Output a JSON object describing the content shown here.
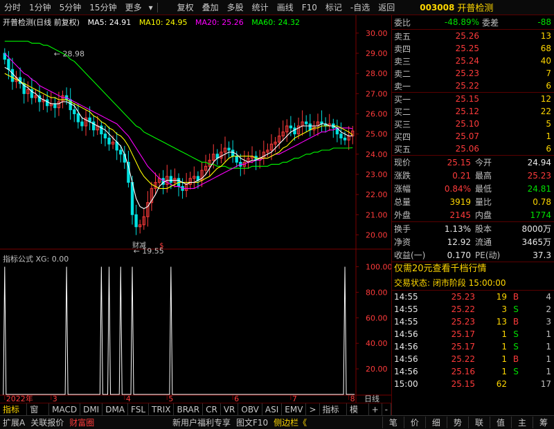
{
  "topbar": {
    "left_buttons": [
      "分时",
      "1分钟",
      "5分钟",
      "15分钟",
      "更多"
    ],
    "right_buttons": [
      "复权",
      "叠加",
      "多股",
      "统计",
      "画线",
      "F10",
      "标记",
      "-自选",
      "返回"
    ],
    "stock_code": "003008",
    "stock_name": "开普检测"
  },
  "chart_header": {
    "title": "开普检测(日线 前复权)",
    "ma5": "MA5: 24.91",
    "ma10": "MA10: 24.95",
    "ma20": "MA20: 25.26",
    "ma60": "MA60: 24.32"
  },
  "indicator_header": {
    "label": "指标公式 XG: 0.00"
  },
  "annotations": {
    "high": "28.98",
    "low": "19.55",
    "note1": "财减",
    "note2": "$"
  },
  "colors": {
    "ma5": "#ffffff",
    "ma10": "#ffff00",
    "ma20": "#ff00ff",
    "ma60": "#00ff00",
    "up": "#ff3b3b",
    "down": "#00e0e0",
    "axis_line": "#7a0000",
    "grid": "#3a0000"
  },
  "chart_data": [
    {
      "type": "candlestick",
      "title": "开普检测(日线 前复权)",
      "xlabel": "",
      "ylabel": "",
      "ylim": [
        19.5,
        30.2
      ],
      "y_ticks": [
        20,
        21,
        22,
        23,
        24,
        25,
        26,
        27,
        28,
        29,
        30
      ],
      "x_ticks": [
        {
          "index": 0,
          "label": "2022年"
        },
        {
          "index": 12,
          "label": "3"
        },
        {
          "index": 31,
          "label": "4"
        },
        {
          "index": 42,
          "label": "5"
        },
        {
          "index": 59,
          "label": "6"
        },
        {
          "index": 74,
          "label": "7"
        },
        {
          "index": 89,
          "label": "8"
        }
      ],
      "x_right_label": "日线",
      "legend": [
        "MA5",
        "MA10",
        "MA20",
        "MA60"
      ],
      "closes": [
        28.7,
        28.2,
        27.6,
        27.8,
        27.5,
        27.0,
        27.2,
        26.8,
        26.9,
        26.6,
        26.7,
        26.4,
        26.5,
        26.3,
        26.6,
        26.9,
        26.7,
        26.2,
        26.0,
        25.6,
        25.4,
        25.8,
        25.6,
        25.2,
        25.4,
        25.0,
        24.8,
        24.5,
        24.6,
        24.2,
        24.0,
        23.6,
        22.6,
        21.0,
        20.4,
        20.5,
        20.9,
        21.6,
        22.3,
        22.6,
        22.8,
        22.5,
        22.9,
        22.6,
        22.8,
        22.4,
        22.2,
        22.5,
        22.8,
        22.9,
        22.7,
        23.2,
        23.4,
        23.7,
        24.0,
        23.8,
        24.1,
        24.3,
        24.2,
        23.9,
        23.6,
        23.4,
        23.6,
        23.8,
        23.9,
        23.7,
        23.8,
        24.1,
        24.2,
        24.5,
        24.6,
        24.9,
        25.1,
        25.4,
        25.3,
        25.0,
        25.4,
        25.6,
        25.5,
        25.2,
        25.4,
        25.6,
        25.5,
        25.4,
        25.5,
        25.3,
        25.0,
        24.8,
        24.7,
        24.9,
        25.15
      ],
      "ma5": [
        28.3,
        28.2,
        28.0,
        27.8,
        27.6,
        27.4,
        27.3,
        27.1,
        27.0,
        26.8,
        26.7,
        26.6,
        26.5,
        26.5,
        26.5,
        26.6,
        26.6,
        26.5,
        26.4,
        26.1,
        25.8,
        25.7,
        25.6,
        25.5,
        25.4,
        25.3,
        25.2,
        25.0,
        24.8,
        24.6,
        24.4,
        24.0,
        23.4,
        22.6,
        21.8,
        21.4,
        21.3,
        21.4,
        21.7,
        22.0,
        22.4,
        22.6,
        22.7,
        22.7,
        22.7,
        22.7,
        22.6,
        22.5,
        22.6,
        22.6,
        22.7,
        22.8,
        23.0,
        23.3,
        23.6,
        23.8,
        23.9,
        24.0,
        24.1,
        24.1,
        24.0,
        23.8,
        23.7,
        23.6,
        23.7,
        23.7,
        23.8,
        23.9,
        24.0,
        24.1,
        24.3,
        24.5,
        24.7,
        24.9,
        25.1,
        25.2,
        25.3,
        25.4,
        25.4,
        25.4,
        25.4,
        25.4,
        25.5,
        25.5,
        25.4,
        25.4,
        25.3,
        25.1,
        25.0,
        24.9,
        24.91
      ],
      "ma10": [
        28.0,
        27.9,
        27.8,
        27.7,
        27.6,
        27.5,
        27.4,
        27.3,
        27.2,
        27.1,
        27.0,
        26.9,
        26.8,
        26.8,
        26.7,
        26.7,
        26.7,
        26.6,
        26.5,
        26.4,
        26.3,
        26.2,
        26.1,
        25.9,
        25.8,
        25.6,
        25.5,
        25.3,
        25.2,
        25.0,
        24.9,
        24.7,
        24.4,
        24.0,
        23.6,
        23.2,
        22.9,
        22.7,
        22.5,
        22.4,
        22.3,
        22.3,
        22.3,
        22.4,
        22.5,
        22.6,
        22.6,
        22.6,
        22.6,
        22.6,
        22.6,
        22.7,
        22.8,
        22.9,
        23.1,
        23.3,
        23.4,
        23.6,
        23.8,
        23.9,
        23.9,
        23.9,
        23.9,
        23.9,
        23.9,
        23.8,
        23.8,
        23.8,
        23.8,
        23.9,
        24.0,
        24.1,
        24.3,
        24.4,
        24.6,
        24.8,
        24.9,
        25.0,
        25.1,
        25.2,
        25.3,
        25.3,
        25.4,
        25.4,
        25.4,
        25.4,
        25.4,
        25.3,
        25.2,
        25.1,
        24.95
      ],
      "ma20": [
        29.0,
        28.8,
        28.6,
        28.4,
        28.2,
        28.0,
        27.9,
        27.7,
        27.6,
        27.4,
        27.3,
        27.2,
        27.1,
        27.0,
        26.9,
        26.8,
        26.8,
        26.7,
        26.6,
        26.5,
        26.4,
        26.3,
        26.2,
        26.1,
        26.0,
        25.9,
        25.8,
        25.7,
        25.6,
        25.5,
        25.3,
        25.1,
        24.9,
        24.6,
        24.3,
        24.0,
        23.7,
        23.4,
        23.2,
        23.0,
        22.8,
        22.7,
        22.6,
        22.5,
        22.4,
        22.4,
        22.3,
        22.3,
        22.3,
        22.3,
        22.4,
        22.5,
        22.6,
        22.7,
        22.8,
        22.9,
        23.0,
        23.1,
        23.2,
        23.3,
        23.4,
        23.5,
        23.5,
        23.6,
        23.6,
        23.7,
        23.7,
        23.8,
        23.8,
        23.9,
        24.0,
        24.0,
        24.1,
        24.2,
        24.3,
        24.4,
        24.5,
        24.6,
        24.7,
        24.8,
        24.9,
        25.0,
        25.1,
        25.1,
        25.2,
        25.2,
        25.3,
        25.3,
        25.3,
        25.3,
        25.26
      ],
      "ma60": [
        29.6,
        29.6,
        29.6,
        29.6,
        29.6,
        29.6,
        29.6,
        29.5,
        29.5,
        29.5,
        29.4,
        29.4,
        29.3,
        29.2,
        29.1,
        29.0,
        28.9,
        28.7,
        28.6,
        28.4,
        28.2,
        28.0,
        27.8,
        27.6,
        27.4,
        27.2,
        27.0,
        26.8,
        26.6,
        26.4,
        26.2,
        26.0,
        25.8,
        25.6,
        25.4,
        25.3,
        25.1,
        25.0,
        24.9,
        24.8,
        24.7,
        24.6,
        24.5,
        24.4,
        24.3,
        24.2,
        24.1,
        24.0,
        23.9,
        23.8,
        23.7,
        23.6,
        23.6,
        23.5,
        23.5,
        23.4,
        23.4,
        23.4,
        23.3,
        23.3,
        23.3,
        23.3,
        23.3,
        23.3,
        23.4,
        23.4,
        23.4,
        23.4,
        23.4,
        23.5,
        23.5,
        23.5,
        23.6,
        23.6,
        23.7,
        23.8,
        23.8,
        23.9,
        24.0,
        24.0,
        24.1,
        24.1,
        24.2,
        24.2,
        24.2,
        24.3,
        24.3,
        24.3,
        24.3,
        24.3,
        24.32
      ]
    },
    {
      "type": "line",
      "title": "指标公式 XG: 0.00",
      "ylim": [
        0,
        110
      ],
      "y_ticks": [
        20,
        40,
        60,
        80,
        100
      ],
      "spikes_at": [
        0,
        16,
        25,
        27,
        30,
        33,
        43,
        88
      ]
    }
  ],
  "orderbook": {
    "header": {
      "wb_label": "委比",
      "wb_value": "-48.89%",
      "wc_label": "委差",
      "wc_value": "-88"
    },
    "asks": [
      {
        "label": "卖五",
        "price": "25.26",
        "vol": "13"
      },
      {
        "label": "卖四",
        "price": "25.25",
        "vol": "68"
      },
      {
        "label": "卖三",
        "price": "25.24",
        "vol": "40"
      },
      {
        "label": "卖二",
        "price": "25.23",
        "vol": "7"
      },
      {
        "label": "卖一",
        "price": "25.22",
        "vol": "6"
      }
    ],
    "bids": [
      {
        "label": "买一",
        "price": "25.15",
        "vol": "12"
      },
      {
        "label": "买二",
        "price": "25.12",
        "vol": "22"
      },
      {
        "label": "买三",
        "price": "25.10",
        "vol": "5"
      },
      {
        "label": "买四",
        "price": "25.07",
        "vol": "1"
      },
      {
        "label": "买五",
        "price": "25.06",
        "vol": "6"
      }
    ]
  },
  "stats": [
    {
      "l1": "现价",
      "v1": "25.15",
      "c1": "red",
      "l2": "今开",
      "v2": "24.94",
      "c2": "white"
    },
    {
      "l1": "涨跌",
      "v1": "0.21",
      "c1": "red",
      "l2": "最高",
      "v2": "25.23",
      "c2": "red"
    },
    {
      "l1": "涨幅",
      "v1": "0.84%",
      "c1": "red",
      "l2": "最低",
      "v2": "24.81",
      "c2": "green"
    },
    {
      "l1": "总量",
      "v1": "3919",
      "c1": "yellow",
      "l2": "量比",
      "v2": "0.78",
      "c2": "yellow"
    },
    {
      "l1": "外盘",
      "v1": "2145",
      "c1": "red",
      "l2": "内盘",
      "v2": "1774",
      "c2": "green"
    }
  ],
  "stats2": [
    {
      "l1": "换手",
      "v1": "1.13%",
      "l2": "股本",
      "v2": "8000万"
    },
    {
      "l1": "净资",
      "v1": "12.92",
      "l2": "流通",
      "v2": "3465万"
    },
    {
      "l1": "收益(一)",
      "v1": "0.170",
      "l2": "PE(动)",
      "v2": "37.3"
    }
  ],
  "banner": "仅需20元查看千档行情",
  "trade_status": "交易状态: 闭市阶段 15:00:00",
  "trades": [
    {
      "time": "14:55",
      "price": "25.23",
      "vol": "19",
      "bs": "B",
      "n": "4"
    },
    {
      "time": "14:55",
      "price": "25.22",
      "vol": "3",
      "bs": "S",
      "n": "2"
    },
    {
      "time": "14:55",
      "price": "25.23",
      "vol": "13",
      "bs": "B",
      "n": "3"
    },
    {
      "time": "14:56",
      "price": "25.17",
      "vol": "1",
      "bs": "S",
      "n": "1"
    },
    {
      "time": "14:56",
      "price": "25.17",
      "vol": "1",
      "bs": "S",
      "n": "1"
    },
    {
      "time": "14:56",
      "price": "25.22",
      "vol": "1",
      "bs": "B",
      "n": "1"
    },
    {
      "time": "14:56",
      "price": "25.16",
      "vol": "1",
      "bs": "S",
      "n": "1"
    },
    {
      "time": "15:00",
      "price": "25.15",
      "vol": "62",
      "bs": "",
      "n": "17"
    }
  ],
  "tabbar": [
    "指标A",
    "窗口",
    "MACD",
    "DMI",
    "DMA",
    "FSL",
    "TRIX",
    "BRAR",
    "CR",
    "VR",
    "OBV",
    "ASI",
    "EMV",
    ">",
    "指标B",
    "模板",
    "+",
    "-"
  ],
  "bottombar": {
    "left": [
      "扩展A",
      "关联报价",
      "财富圈"
    ],
    "mid": [
      "新用户福利专享",
      "图文F10",
      "侧边栏《"
    ],
    "right_icons": [
      "笔",
      "价",
      "细",
      "势",
      "联",
      "值",
      "主",
      "筹"
    ]
  }
}
